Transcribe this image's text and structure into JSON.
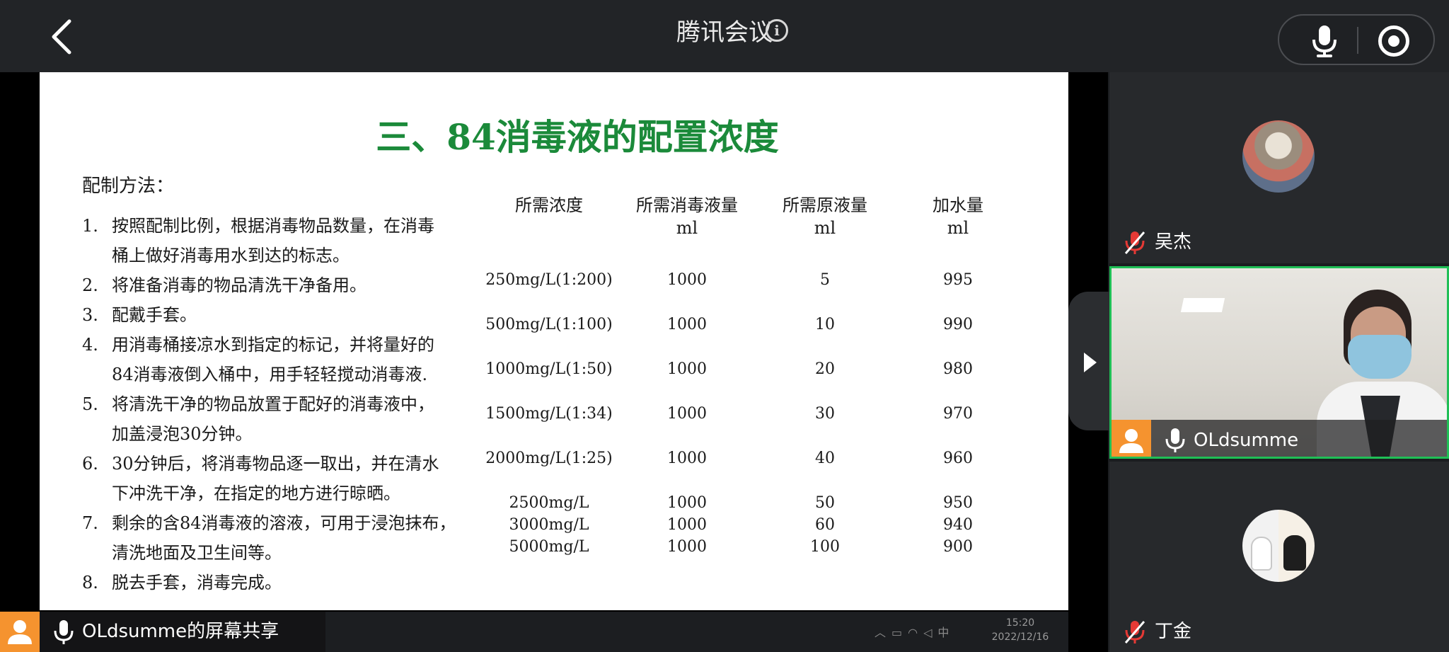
{
  "app": {
    "title": "腾讯会议"
  },
  "slide": {
    "title": "三、84消毒液的配置浓度",
    "method_heading": "配制方法：",
    "steps": [
      {
        "num": "1.",
        "lines": [
          "按照配制比例，根据消毒物品数量，在消毒",
          "桶上做好消毒用水到达的标志。"
        ]
      },
      {
        "num": "2.",
        "lines": [
          "将准备消毒的物品清洗干净备用。"
        ]
      },
      {
        "num": "3.",
        "lines": [
          "配戴手套。"
        ]
      },
      {
        "num": "4.",
        "lines": [
          "用消毒桶接凉水到指定的标记，并将量好的",
          "84消毒液倒入桶中，用手轻轻搅动消毒液."
        ]
      },
      {
        "num": "5.",
        "lines": [
          "将清洗干净的物品放置于配好的消毒液中，",
          "加盖浸泡30分钟。"
        ]
      },
      {
        "num": "6.",
        "lines": [
          "30分钟后，将消毒物品逐一取出，并在清水",
          "下冲洗干净，在指定的地方进行晾晒。"
        ]
      },
      {
        "num": "7.",
        "lines": [
          "剩余的含84消毒液的溶液，可用于浸泡抹布，",
          "清洗地面及卫生间等。"
        ]
      },
      {
        "num": "8.",
        "lines": [
          "脱去手套，消毒完成。"
        ]
      }
    ],
    "table": {
      "headers": [
        [
          "所需浓度"
        ],
        [
          "所需消毒液量",
          "ml"
        ],
        [
          "所需原液量",
          "ml"
        ],
        [
          "加水量",
          "ml"
        ]
      ],
      "rows": [
        [
          "250mg/L(1:200)",
          "1000",
          "5",
          "995"
        ],
        [
          "500mg/L(1:100)",
          "1000",
          "10",
          "990"
        ],
        [
          "1000mg/L(1:50)",
          "1000",
          "20",
          "980"
        ],
        [
          "1500mg/L(1:34)",
          "1000",
          "30",
          "970"
        ],
        [
          "2000mg/L(1:25)",
          "1000",
          "40",
          "960"
        ],
        [
          "2500mg/L",
          "1000",
          "50",
          "950"
        ],
        [
          "3000mg/L",
          "1000",
          "60",
          "940"
        ],
        [
          "5000mg/L",
          "1000",
          "100",
          "900"
        ]
      ]
    }
  },
  "taskbar": {
    "time": "15:20",
    "date": "2022/12/16",
    "ime": "中"
  },
  "share": {
    "label": "OLdsumme的屏幕共享"
  },
  "participants": [
    {
      "name": "吴杰",
      "muted": true
    },
    {
      "name": "OLdsumme",
      "muted": false
    },
    {
      "name": "丁金",
      "muted": true
    }
  ],
  "colors": {
    "accent_green": "#1fbf56",
    "avatar_orange": "#f5932f",
    "title_green": "#1b8a3a",
    "muted_red": "#e53935"
  }
}
